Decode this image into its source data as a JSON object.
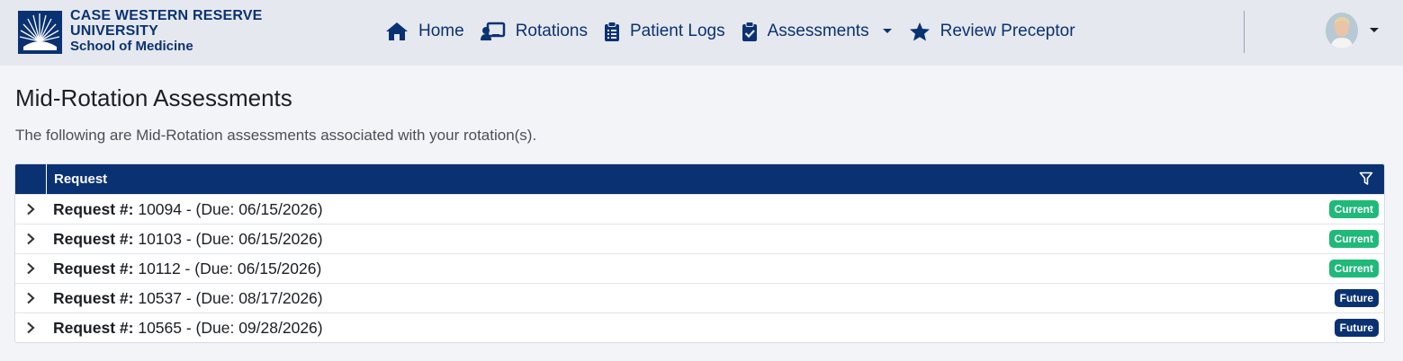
{
  "logo": {
    "line1": "CASE WESTERN RESERVE",
    "line2": "UNIVERSITY",
    "line3": "School of Medicine"
  },
  "nav": {
    "items": [
      {
        "label": "Home",
        "icon": "home-icon"
      },
      {
        "label": "Rotations",
        "icon": "rotations-icon"
      },
      {
        "label": "Patient Logs",
        "icon": "clipboard-icon"
      },
      {
        "label": "Assessments",
        "icon": "clipboard-check-icon"
      },
      {
        "label": "Review Preceptor",
        "icon": "star-icon"
      }
    ]
  },
  "page": {
    "title": "Mid-Rotation Assessments",
    "description": "The following are Mid-Rotation assessments associated with your rotation(s)."
  },
  "grid": {
    "column_header": "Request",
    "rows": [
      {
        "prefix": "Request #:",
        "detail": " 10094 - (Due: 06/15/2026)",
        "status": "Current"
      },
      {
        "prefix": "Request #:",
        "detail": " 10103 - (Due: 06/15/2026)",
        "status": "Current"
      },
      {
        "prefix": "Request #:",
        "detail": " 10112 - (Due: 06/15/2026)",
        "status": "Current"
      },
      {
        "prefix": "Request #:",
        "detail": " 10537 - (Due: 08/17/2026)",
        "status": "Future"
      },
      {
        "prefix": "Request #:",
        "detail": " 10565 - (Due: 09/28/2026)",
        "status": "Future"
      }
    ]
  },
  "colors": {
    "brand_navy": "#0a3272",
    "current_badge": "#1fb97a",
    "future_badge": "#0a3272",
    "topbar_bg": "#e5e8ef",
    "page_bg": "#f3f4f8"
  }
}
